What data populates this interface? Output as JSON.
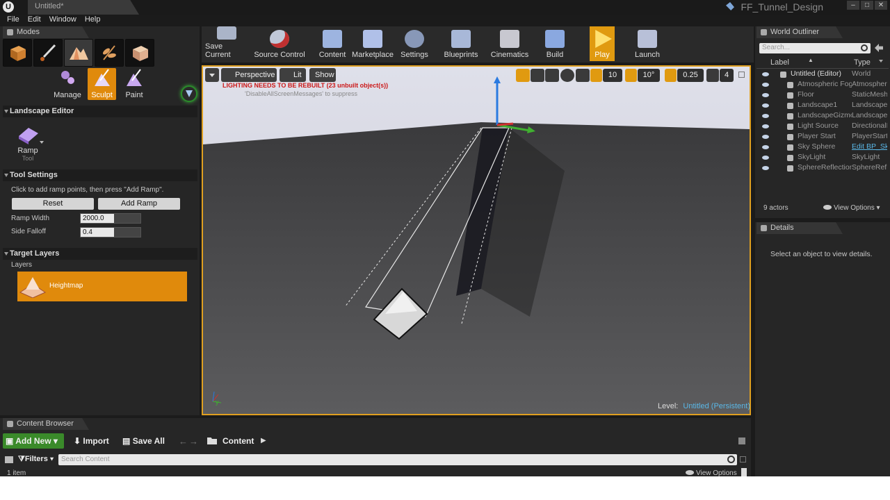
{
  "window": {
    "tab_title": "Untitled*",
    "project_name": "FF_Tunnel_Design"
  },
  "menu": [
    "File",
    "Edit",
    "Window",
    "Help"
  ],
  "modes_panel": {
    "tab_label": "Modes",
    "sub_modes": [
      {
        "label": "Manage"
      },
      {
        "label": "Sculpt"
      },
      {
        "label": "Paint"
      }
    ],
    "landscape_editor": {
      "title": "Landscape Editor",
      "tool_name": "Ramp",
      "tool_sub": "Tool"
    },
    "tool_settings": {
      "title": "Tool Settings",
      "hint": "Click to add ramp points, then press \"Add Ramp\".",
      "reset_label": "Reset",
      "add_ramp_label": "Add Ramp",
      "ramp_width_label": "Ramp Width",
      "ramp_width_value": "2000.0",
      "side_falloff_label": "Side Falloff",
      "side_falloff_value": "0.4"
    },
    "target_layers": {
      "title": "Target Layers",
      "layers_label": "Layers",
      "layer_name": "Heightmap"
    }
  },
  "toolbar": {
    "buttons": [
      {
        "label": "Save Current"
      },
      {
        "label": "Source Control"
      },
      {
        "label": "Content"
      },
      {
        "label": "Marketplace"
      },
      {
        "label": "Settings"
      },
      {
        "label": "Blueprints"
      },
      {
        "label": "Cinematics"
      },
      {
        "label": "Build"
      },
      {
        "label": "Play"
      },
      {
        "label": "Launch"
      }
    ]
  },
  "viewport": {
    "perspective_label": "Perspective",
    "lit_label": "Lit",
    "show_label": "Show",
    "warning": "LIGHTING NEEDS TO BE REBUILT (23 unbuilt object(s))",
    "suppress_hint": "'DisableAllScreenMessages' to suppress",
    "grid_snap": "10",
    "rotation_snap": "10°",
    "scale_snap": "0.25",
    "camera_speed": "4",
    "level_label": "Level:",
    "level_value": "Untitled (Persistent)"
  },
  "world_outliner": {
    "tab_label": "World Outliner",
    "search_placeholder": "Search...",
    "col_label": "Label",
    "col_type": "Type",
    "rows": [
      {
        "label": "Untitled (Editor)",
        "type": "World"
      },
      {
        "label": "Atmospheric Fog",
        "type": "AtmosphericFog"
      },
      {
        "label": "Floor",
        "type": "StaticMeshActor"
      },
      {
        "label": "Landscape1",
        "type": "Landscape"
      },
      {
        "label": "LandscapeGizmo",
        "type": "LandscapeGizmo"
      },
      {
        "label": "Light Source",
        "type": "DirectionalLight"
      },
      {
        "label": "Player Start",
        "type": "PlayerStart"
      },
      {
        "label": "Sky Sphere",
        "type": "Edit BP_Sky_Sphere"
      },
      {
        "label": "SkyLight",
        "type": "SkyLight"
      },
      {
        "label": "SphereReflectionCapture",
        "type": "SphereReflectionCapture"
      }
    ],
    "actor_count": "9 actors",
    "view_options": "View Options"
  },
  "details": {
    "tab_label": "Details",
    "empty_text": "Select an object to view details."
  },
  "content_browser": {
    "tab_label": "Content Browser",
    "add_new": "Add New",
    "import": "Import",
    "save_all": "Save All",
    "path": "Content",
    "filters": "Filters",
    "search_placeholder": "Search Content",
    "item_count": "1 item",
    "view_options": "View Options"
  },
  "colors": {
    "accent_orange": "#e08a0c",
    "warning_red": "#cc1818",
    "add_new_green": "#3a8a2a"
  }
}
